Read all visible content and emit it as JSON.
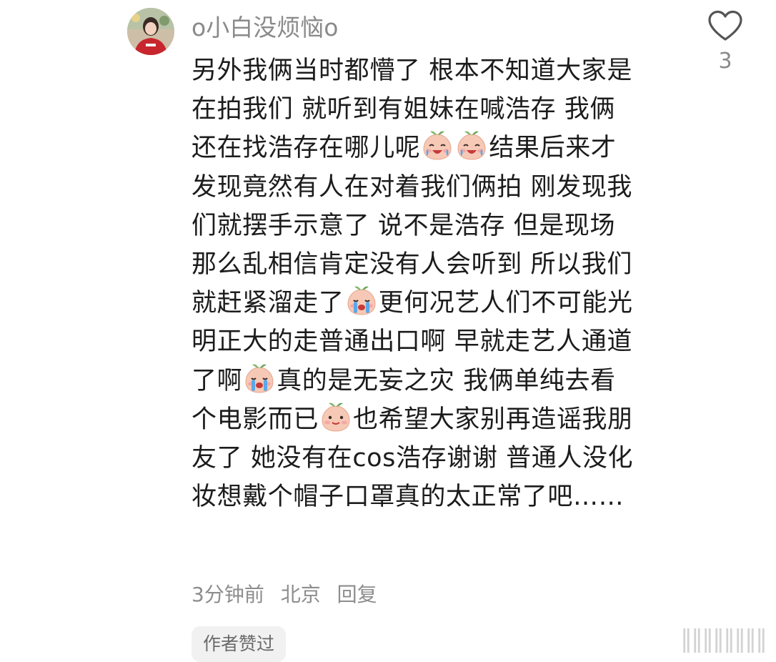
{
  "comment": {
    "username": "o小白没烦恼o",
    "lines": [
      [
        {
          "t": "另外我俩当时都懵了 根本不知道大家是"
        }
      ],
      [
        {
          "t": "在拍我们 就听到有姐妹在喊浩存 我俩"
        }
      ],
      [
        {
          "t": "还在找浩存在哪儿呢"
        },
        {
          "e": "laugh-cry-emoji"
        },
        {
          "e": "laugh-cry-emoji"
        },
        {
          "t": "结果后来才"
        }
      ],
      [
        {
          "t": "发现竟然有人在对着我们俩拍 刚发现我"
        }
      ],
      [
        {
          "t": "们就摆手示意了 说不是浩存 但是现场"
        }
      ],
      [
        {
          "t": "那么乱相信肯定没有人会听到 所以我们"
        }
      ],
      [
        {
          "t": "就赶紧溜走了"
        },
        {
          "e": "crying-emoji"
        },
        {
          "t": "更何况艺人们不可能光"
        }
      ],
      [
        {
          "t": "明正大的走普通出口啊 早就走艺人通道"
        }
      ],
      [
        {
          "t": "了啊"
        },
        {
          "e": "crying-emoji"
        },
        {
          "t": "真的是无妄之灾 我俩单纯去看"
        }
      ],
      [
        {
          "t": "个电影而已"
        },
        {
          "e": "smile-emoji"
        },
        {
          "t": "也希望大家别再造谣我朋"
        }
      ],
      [
        {
          "t": "友了 她没有在cos浩存谢谢 普通人没化"
        }
      ],
      [
        {
          "t": "妆想戴个帽子口罩真的太正常了吧……"
        }
      ]
    ],
    "time": "3分钟前",
    "location": "北京",
    "reply_label": "回复",
    "author_liked_label": "作者赞过"
  },
  "like": {
    "count": "3",
    "icon": "heart-outline-icon"
  },
  "colors": {
    "text": "#1c1c1c",
    "secondary": "#8a8a8a",
    "badge_bg": "#f1f1f1"
  }
}
